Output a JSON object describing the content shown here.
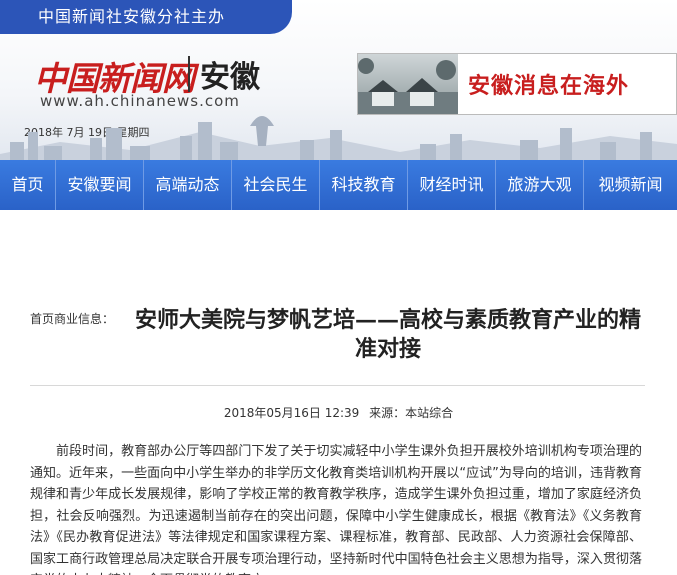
{
  "header": {
    "sponsor": "中国新闻社安徽分社主办",
    "logo_cn": "中国新闻网",
    "logo_region": "安徽",
    "url": "www.ah.chinanews.com",
    "date": "2018年 7月 19日   星期四",
    "banner_text": "安徽消息在海外"
  },
  "nav": {
    "items": [
      "首页",
      "安徽要闻",
      "高端动态",
      "社会民生",
      "科技教育",
      "财经时讯",
      "旅游大观",
      "视频新闻"
    ]
  },
  "article": {
    "breadcrumb": "首页商业信息：",
    "title": "安师大美院与梦帆艺培——高校与素质教育产业的精准对接",
    "date": "2018年05月16日  12:39",
    "source": "来源：本站综合",
    "body": "前段时间，教育部办公厅等四部门下发了关于切实减轻中小学生课外负担开展校外培训机构专项治理的通知。近年来，一些面向中小学生举办的非学历文化教育类培训机构开展以“应试”为导向的培训，违背教育规律和青少年成长发展规律，影响了学校正常的教育教学秩序，造成学生课外负担过重，增加了家庭经济负担，社会反响强烈。为迅速遏制当前存在的突出问题，保障中小学生健康成长，根据《教育法》《义务教育法》《民办教育促进法》等法律规定和国家课程方案、课程标准，教育部、民政部、人力资源社会保障部、国家工商行政管理总局决定联合开展专项治理行动，坚持新时代中国特色社会主义思想为指导，深入贯彻落实党的十九大精神，全面贯彻党的教育方"
  },
  "colors": {
    "brand_blue": "#2c55b8",
    "nav_blue": "#3a7be0",
    "logo_red": "#c81e1e"
  }
}
